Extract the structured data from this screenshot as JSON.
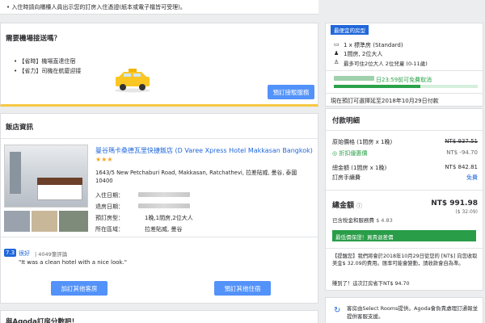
{
  "top_note": "入住時請向櫃檯人員出示您的訂房入住憑證(紙本或電子檔皆可受理)。",
  "airport": {
    "title": "需要機場接送嗎？",
    "points": [
      "【省時】機場直達住宿",
      "【省力】司機在航廈迎接"
    ],
    "button": "預訂接駁服務"
  },
  "hotel_section": {
    "title": "飯店資訊",
    "name": "曼谷瑪卡桑德瓦里快捷飯店 (D Varee Xpress Hotel Makkasan Bangkok)",
    "stars": "★★★",
    "address": "1643/5 New Petchaburi Road, Makkasan, Ratchathevi, 拉差貼威, 曼谷, 泰國 10400",
    "details": [
      {
        "label": "入住日期：",
        "value": ""
      },
      {
        "label": "退房日期：",
        "value": ""
      },
      {
        "label": "預訂房型：",
        "value": "1晚,1間房,2位大人"
      },
      {
        "label": "所在區域：",
        "value": "拉差貼威, 曼谷"
      }
    ],
    "score": "7.3",
    "score_label": "很好",
    "review_count": "| 4049筆評論",
    "review_quote": "\"It was a clean hotel with a nice look.\"",
    "btn_left": "加訂其他客房",
    "btn_right": "預訂其他住宿"
  },
  "bottom_title": "與Agoda訂房分數吧！",
  "booking_summary": {
    "badge": "最便宜的房型",
    "room": "1 x 標準房 (Standard)",
    "guests": "1間房, 2位大人",
    "max": "最多可住2位大人 2位兒童 (0-11歲)",
    "cancel": "日23:59前可免費取消",
    "pay_later": "現在預訂可選擇延至2018年10月29日付款"
  },
  "payment": {
    "title": "付款明細",
    "lines": [
      {
        "label": "原始價格 (1間房 x 1晚)",
        "value": "NT$ 937.51"
      },
      {
        "label": "折扣優惠價",
        "value": "NT$ -94.70"
      },
      {
        "label": "總金額 (1間房 x 1晚)",
        "value": "NT$ 842.81"
      },
      {
        "label": "訂房手續費",
        "value": "免費"
      }
    ],
    "total_label": "總金額",
    "total_value": "NT$ 991.98",
    "total_sub": "($ 32.09)",
    "tax_label": "已含稅金和服務費",
    "tax_value": "$ 4.83",
    "guarantee": "最低價保證！買貴退差價",
    "notice": "【提醒您】我們將會於2018年10月29日從您的 [NT$] 向您收取美金$ 32.09的費用。匯率可能會變動，請收款會自為準。",
    "saved": "賺到了！這次訂房省下NT$ 94.70",
    "footer": "客房由Select Rooms提供。Agoda會負責處理訂通報並提供客服支援。"
  }
}
